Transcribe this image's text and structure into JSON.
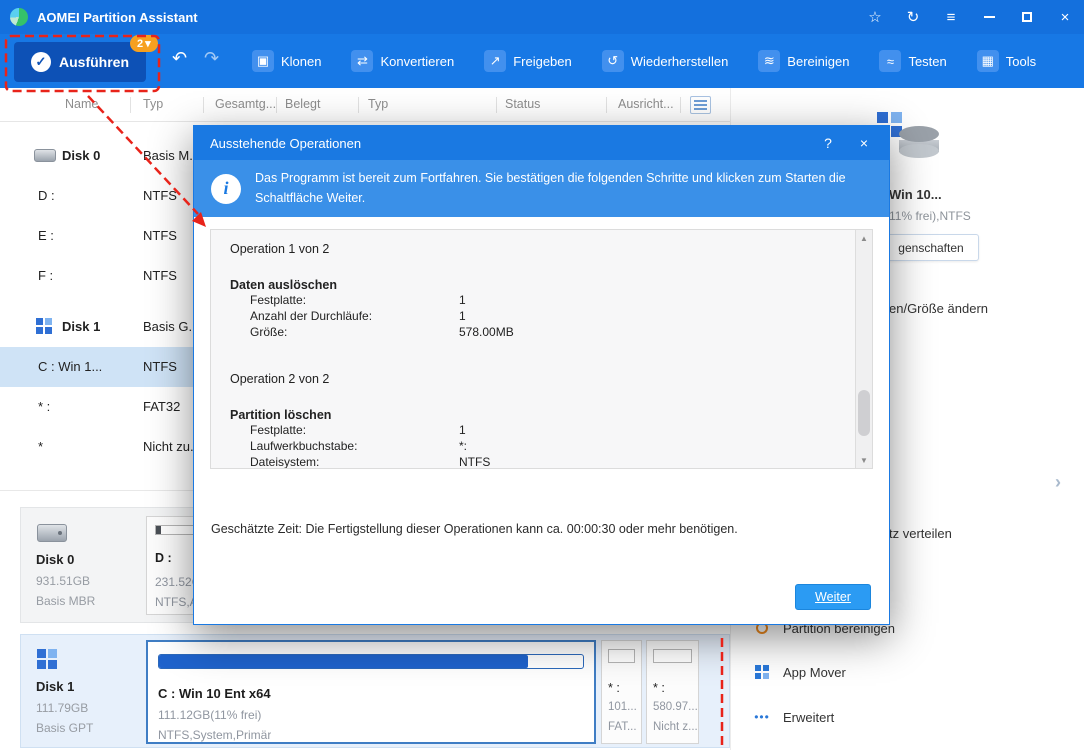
{
  "titlebar": {
    "title": "AOMEI Partition Assistant",
    "star_icon": "☆",
    "sync_icon": "↻",
    "menu_icon": "≡",
    "close_icon": "×"
  },
  "toolbar": {
    "apply_label": "Ausführen",
    "apply_check": "✓",
    "apply_badge": "2",
    "apply_badge_caret": "▾",
    "undo_icon": "↶",
    "redo_icon": "↷",
    "items": [
      {
        "label": "Klonen",
        "icon": "▣"
      },
      {
        "label": "Konvertieren",
        "icon": "⇄"
      },
      {
        "label": "Freigeben",
        "icon": "↗"
      },
      {
        "label": "Wiederherstellen",
        "icon": "↺"
      },
      {
        "label": "Bereinigen",
        "icon": "≋"
      },
      {
        "label": "Testen",
        "icon": "≈"
      },
      {
        "label": "Tools",
        "icon": "▦"
      }
    ]
  },
  "table": {
    "columns": [
      "Name",
      "Typ",
      "Gesamtg...",
      "Belegt",
      "Typ",
      "Status",
      "Ausricht..."
    ],
    "rows": [
      {
        "name": "Disk 0",
        "typ": "Basis M..."
      },
      {
        "name": "D :",
        "typ": "NTFS"
      },
      {
        "name": "E :",
        "typ": "NTFS"
      },
      {
        "name": "F :",
        "typ": "NTFS"
      },
      {
        "name": "Disk 1",
        "typ": "Basis G..."
      },
      {
        "name": "C : Win 1...",
        "typ": "NTFS"
      },
      {
        "name": "* :",
        "typ": "FAT32"
      },
      {
        "name": "*",
        "typ": "Nicht zu..."
      }
    ]
  },
  "disks": {
    "disk0": {
      "name": "Disk 0",
      "size": "931.51GB",
      "scheme": "Basis MBR",
      "partitions": [
        {
          "name": "D :",
          "size": "231.52G",
          "fs": "NTFS,A...",
          "used_pct": 7
        }
      ]
    },
    "disk1": {
      "name": "Disk 1",
      "size": "111.79GB",
      "scheme": "Basis GPT",
      "partitions": [
        {
          "name": "C : Win 10 Ent x64",
          "size": "111.12GB(11% frei)",
          "fs": "NTFS,System,Primär",
          "used_pct": 87
        },
        {
          "name": "* :",
          "size": "101...",
          "fs": "FAT..."
        },
        {
          "name": "* :",
          "size": "580.97...",
          "fs": "Nicht z..."
        }
      ]
    }
  },
  "right_panel": {
    "volume_title": "Win 10...",
    "volume_sub": "11% frei),NTFS",
    "properties_label": "genschaften",
    "resize_label": "en/Größe ändern",
    "chevron_icon": "›",
    "distribute_label": "tz verteilen",
    "menu": [
      {
        "label": "Partition bereinigen"
      },
      {
        "label": "App Mover"
      },
      {
        "label": "Erweitert",
        "icon": "•••"
      }
    ]
  },
  "dialog": {
    "title": "Ausstehende Operationen",
    "help_icon": "?",
    "close_icon": "×",
    "info_icon": "i",
    "info_text": "Das Programm ist bereit zum Fortfahren. Sie bestätigen die folgenden Schritte und klicken zum Starten die Schaltfläche Weiter.",
    "operations": [
      {
        "header": "Operation 1 von 2",
        "name": "Daten auslöschen",
        "details": [
          {
            "label": "Festplatte:",
            "value": "1"
          },
          {
            "label": "Anzahl der Durchläufe:",
            "value": "1"
          },
          {
            "label": "Größe:",
            "value": "578.00MB"
          }
        ]
      },
      {
        "header": "Operation 2 von 2",
        "name": "Partition löschen",
        "details": [
          {
            "label": "Festplatte:",
            "value": "1"
          },
          {
            "label": "Laufwerkbuchstabe:",
            "value": "*:"
          },
          {
            "label": "Dateisystem:",
            "value": "NTFS"
          }
        ]
      }
    ],
    "scroll_up_icon": "▲",
    "scroll_down_icon": "▼",
    "estimate_text": "Geschätzte Zeit: Die Fertigstellung dieser Operationen kann ca. 00:00:30 oder mehr benötigen.",
    "next_label": "Weiter"
  }
}
